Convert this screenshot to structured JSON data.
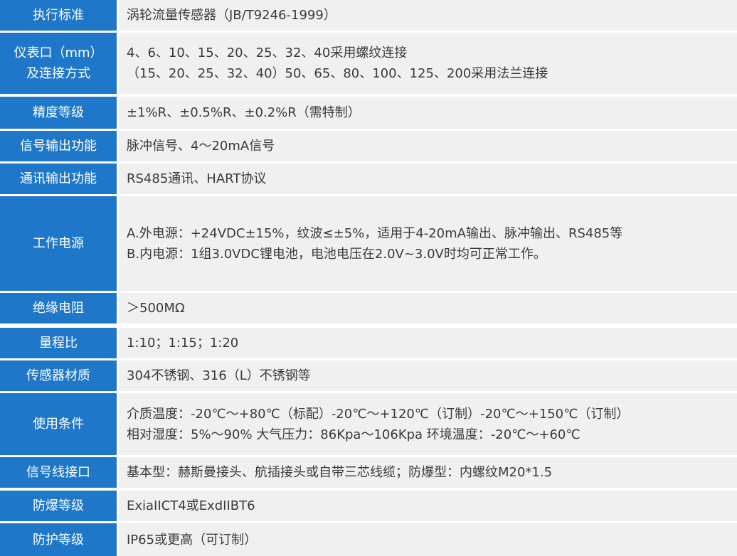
{
  "rows": [
    {
      "label": [
        "执行标准"
      ],
      "value": [
        "涡轮流量传感器（JB/T9246-1999）"
      ]
    },
    {
      "label": [
        "仪表口（mm）",
        "及连接方式"
      ],
      "value": [
        "4、6、10、15、20、25、32、40采用螺纹连接",
        "（15、20、25、32、40）50、65、80、100、125、200采用法兰连接"
      ]
    },
    {
      "label": [
        "精度等级"
      ],
      "value": [
        "±1%R、±0.5%R、±0.2%R（需特制）"
      ]
    },
    {
      "label": [
        "信号输出功能"
      ],
      "value": [
        "脉冲信号、4～20mA信号"
      ]
    },
    {
      "label": [
        "通讯输出功能"
      ],
      "value": [
        "RS485通讯、HART协议"
      ]
    },
    {
      "label": [
        "工作电源"
      ],
      "value": [
        "A.外电源：+24VDC±15%，纹波≤±5%，适用于4-20mA输出、脉冲输出、RS485等",
        "B.内电源：1组3.0VDC锂电池，电池电压在2.0V~3.0V时均可正常工作。"
      ]
    },
    {
      "label": [
        "绝缘电阻"
      ],
      "value": [
        "＞500MΩ"
      ]
    },
    {
      "label": [
        "量程比"
      ],
      "value": [
        "1:10；1:15；1:20"
      ]
    },
    {
      "label": [
        "传感器材质"
      ],
      "value": [
        "304不锈钢、316（L）不锈钢等"
      ]
    },
    {
      "label": [
        "使用条件"
      ],
      "value": [
        "介质温度：-20℃～+80℃（标配）-20℃～+120℃（订制）-20℃～+150℃（订制）",
        "相对湿度：5%～90% 大气压力：86Kpa～106Kpa 环境温度：-20℃～+60℃"
      ]
    },
    {
      "label": [
        "信号线接口"
      ],
      "value": [
        "基本型：赫斯曼接头、航插接头或自带三芯线缆；防爆型：内螺纹M20*1.5"
      ]
    },
    {
      "label": [
        "防爆等级"
      ],
      "value": [
        "ExiaIICT4或ExdIIBT6"
      ]
    },
    {
      "label": [
        "防护等级"
      ],
      "value": [
        "IP65或更高（可订制）"
      ]
    }
  ]
}
